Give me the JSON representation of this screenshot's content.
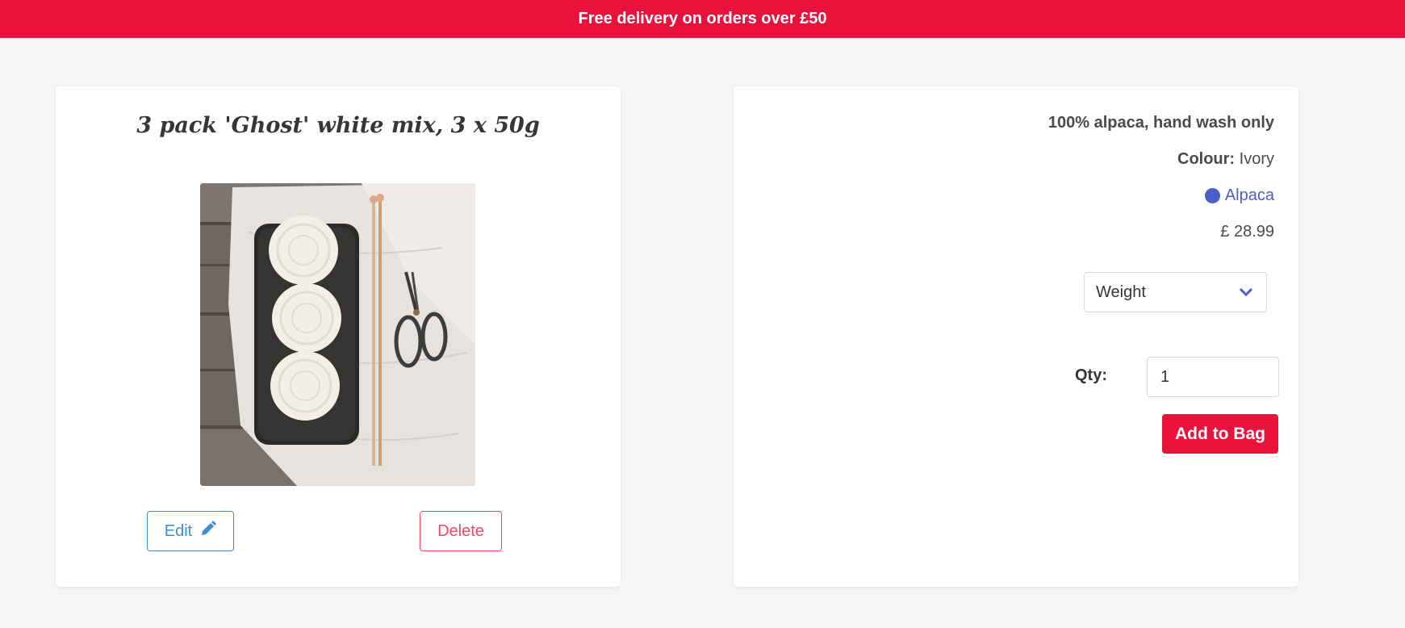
{
  "banner": {
    "text": "Free delivery on orders over £50"
  },
  "product": {
    "title": "3 pack 'Ghost' white mix, 3 x 50g",
    "image_alt": "Three balls of ivory yarn on a dark tray with knitting needles and scissors",
    "edit_label": "Edit",
    "delete_label": "Delete",
    "edit_icon": "pencil-icon"
  },
  "details": {
    "care": "100% alpaca, hand wash only",
    "colour_label": "Colour:",
    "colour_value": "Ivory",
    "material": "Alpaca",
    "price": "£ 28.99",
    "weight_select": {
      "selected": "Weight",
      "icon": "chevron-down-icon"
    },
    "qty_label": "Qty:",
    "qty_value": "1",
    "add_to_bag_label": "Add to Bag"
  },
  "colors": {
    "brand": "#e8123c",
    "link": "#485fc7",
    "edit": "#3e8ed0",
    "delete": "#f14668"
  }
}
